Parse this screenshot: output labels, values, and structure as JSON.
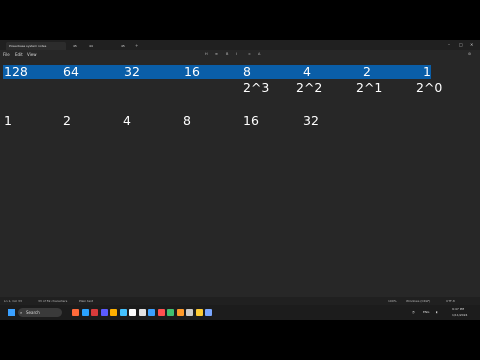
{
  "window": {
    "tab_title": "Powerbase system notes",
    "other_tabs": [
      "45",
      "44",
      "45"
    ],
    "new_tab": "+"
  },
  "menu": {
    "file": "File",
    "edit": "Edit",
    "view": "View"
  },
  "editor": {
    "line1": [
      "128",
      "64",
      "32",
      "16",
      "8",
      "4",
      "2",
      "1"
    ],
    "line2": [
      "2^3",
      "2^2",
      "2^1",
      "2^0"
    ],
    "line3": [
      "1",
      "2",
      "4",
      "8",
      "16",
      "32"
    ]
  },
  "statusbar": {
    "position": "Ln 1, Col 33",
    "selection": "33 of 59 characters",
    "mode": "Plain text",
    "zoom": "100%",
    "line_ending": "Windows (CRLF)",
    "encoding": "UTF-8"
  },
  "taskbar": {
    "search_placeholder": "Search",
    "time": "9:47 PM",
    "date": "1/11/2024",
    "lang": "ENG",
    "icon_colors": [
      "#ff6a3a",
      "#2aa3ff",
      "#d83b3b",
      "#5b5bff",
      "#ffb000",
      "#44c2ff",
      "#ffffff",
      "#e2e2e2",
      "#3aa0ff",
      "#ff5050",
      "#40c070",
      "#ff9a2a",
      "#cccccc",
      "#ffcc33",
      "#7aa7ff"
    ]
  }
}
